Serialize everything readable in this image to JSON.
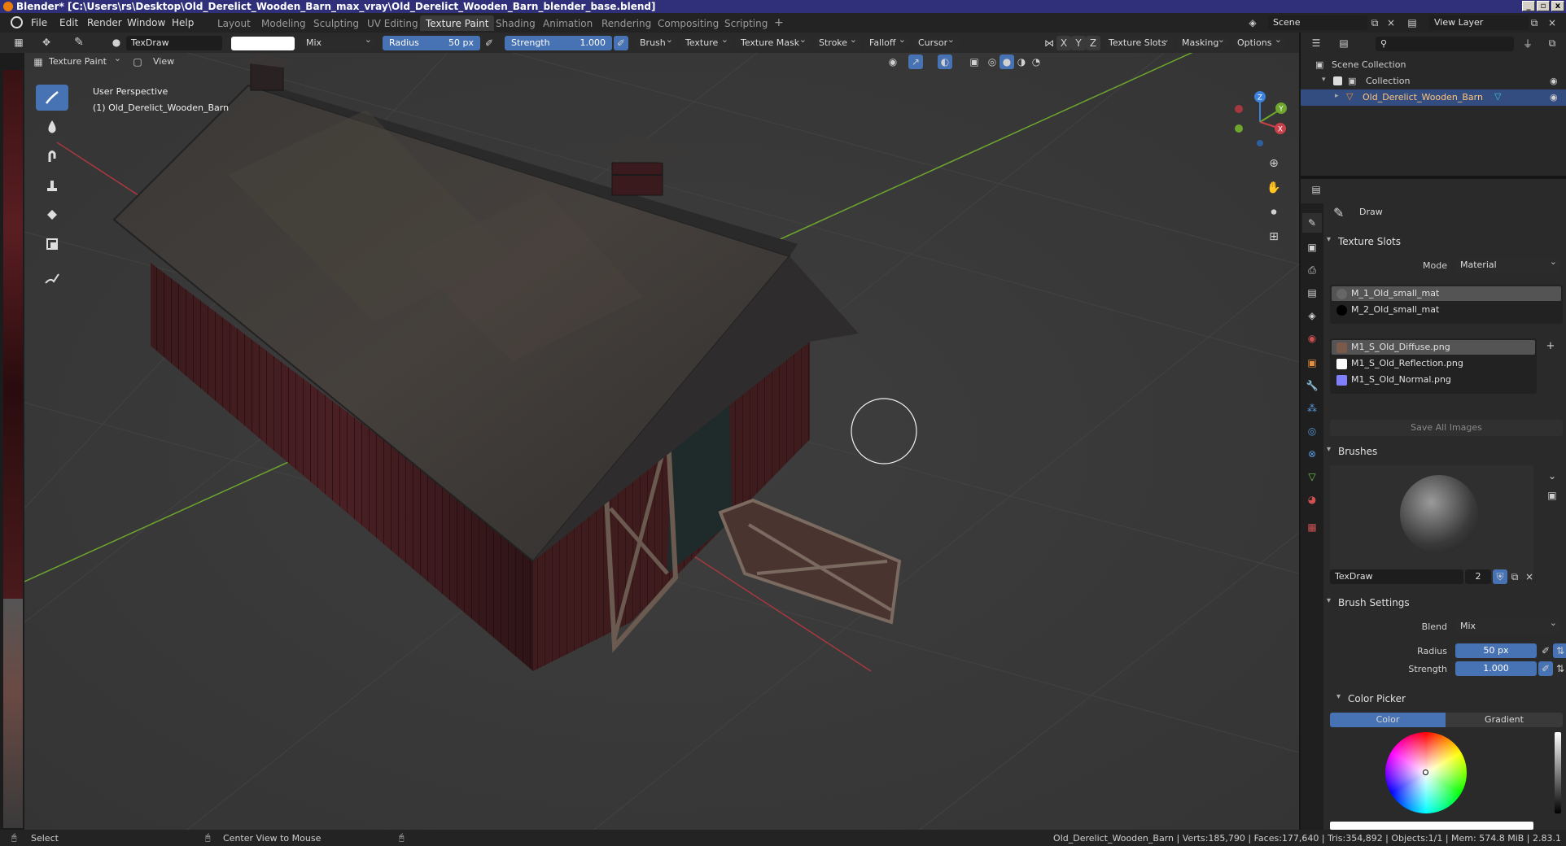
{
  "window": {
    "title": "Blender* [C:\\Users\\rs\\Desktop\\Old_Derelict_Wooden_Barn_max_vray\\Old_Derelict_Wooden_Barn_blender_base.blend]"
  },
  "menu": [
    "File",
    "Edit",
    "Render",
    "Window",
    "Help"
  ],
  "workspaces": [
    "Layout",
    "Modeling",
    "Sculpting",
    "UV Editing",
    "Texture Paint",
    "Shading",
    "Animation",
    "Rendering",
    "Compositing",
    "Scripting"
  ],
  "active_workspace": "Texture Paint",
  "scene": {
    "name": "Scene",
    "view_layer": "View Layer"
  },
  "tool_header": {
    "brush_name": "TexDraw",
    "color_hex": "#ffffff",
    "blend": "Mix",
    "radius_label": "Radius",
    "radius_value": "50 px",
    "strength_label": "Strength",
    "strength_value": "1.000",
    "menus": [
      "Brush",
      "Texture",
      "Texture Mask",
      "Stroke",
      "Falloff",
      "Cursor"
    ],
    "axes": [
      "X",
      "Y",
      "Z"
    ],
    "right_menus": [
      "Texture Slots",
      "Masking",
      "Options"
    ]
  },
  "view_header": {
    "mode": "Texture Paint",
    "view_menu": "View"
  },
  "viewport": {
    "perspective": "User Perspective",
    "object_label": "(1) Old_Derelict_Wooden_Barn"
  },
  "outliner": {
    "root": "Scene Collection",
    "collection": "Collection",
    "object": "Old_Derelict_Wooden_Barn"
  },
  "properties": {
    "active_tool": "Draw",
    "texture_slots": {
      "title": "Texture Slots",
      "mode_label": "Mode",
      "mode_value": "Material",
      "materials": [
        "M_1_Old_small_mat",
        "M_2_Old_small_mat"
      ],
      "images": [
        {
          "name": "M1_S_Old_Diffuse.png",
          "color": "#7a5a4a"
        },
        {
          "name": "M1_S_Old_Reflection.png",
          "color": "#ffffff"
        },
        {
          "name": "M1_S_Old_Normal.png",
          "color": "#8080ff"
        }
      ],
      "save_all": "Save All Images"
    },
    "brushes": {
      "title": "Brushes",
      "brush_name": "TexDraw",
      "users": "2"
    },
    "brush_settings": {
      "title": "Brush Settings",
      "blend_label": "Blend",
      "blend_value": "Mix",
      "radius_label": "Radius",
      "radius_value": "50 px",
      "strength_label": "Strength",
      "strength_value": "1.000"
    },
    "color_picker": {
      "title": "Color Picker",
      "tab_color": "Color",
      "tab_gradient": "Gradient"
    }
  },
  "statusbar": {
    "left_action": "Select",
    "mid_action": "Center View to Mouse",
    "stats": "Old_Derelict_Wooden_Barn | Verts:185,790 | Faces:177,640 | Tris:354,892 | Objects:1/1 | Mem: 574.8 MiB | 2.83.1"
  },
  "colors": {
    "accent": "#4772b3",
    "selected_row": "#334d80",
    "x_axis": "#c8404a",
    "y_axis": "#6ea62e",
    "z_axis": "#3c82dc"
  }
}
